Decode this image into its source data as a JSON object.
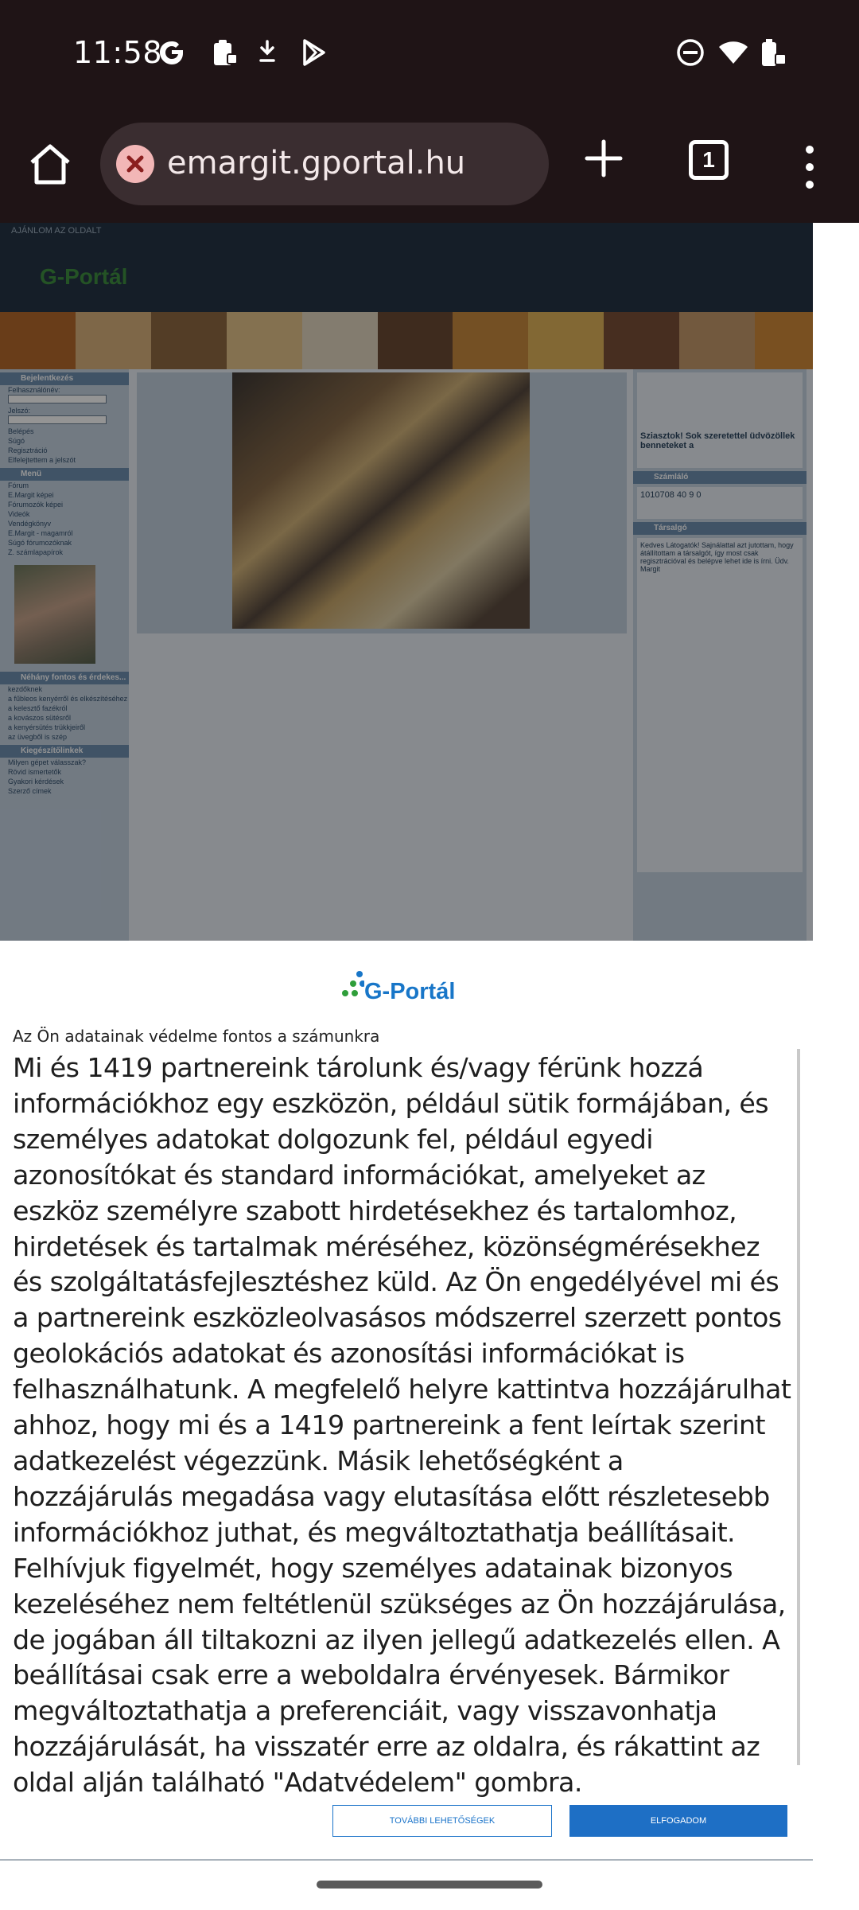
{
  "status_bar": {
    "time": "11:58",
    "left_icons": [
      "google-icon",
      "clipboard-lock-icon",
      "download-icon",
      "play-store-icon"
    ],
    "right_icons": [
      "do-not-disturb-icon",
      "wifi-icon",
      "battery-charging-icon"
    ]
  },
  "browser": {
    "url": "emargit.gportal.hu",
    "tab_count": "1",
    "icons": [
      "home-icon",
      "site-info-warning-icon",
      "new-tab-icon",
      "tabs-icon",
      "more-menu-icon"
    ]
  },
  "website": {
    "recommend_link": "AJÁNLOM AZ OLDALT",
    "logo_text": "G-Portál",
    "login": {
      "heading": "Bejelentkezés",
      "user_label": "Felhasználónév:",
      "password_label": "Jelszó:",
      "login_button": "Belépés",
      "help_link": "Súgó",
      "register_link": "Regisztráció",
      "forgot_link": "Elfelejtettem a jelszót"
    },
    "menu": {
      "heading": "Menü",
      "items": [
        "Fórum",
        "E.Margit képei",
        "Fórumozók képei",
        "Videók",
        "Vendégkönyv",
        "E.Margit - magamról",
        "Súgó fórumozóknak",
        "Z. számlapapírok"
      ]
    },
    "recipes": {
      "heading": "Néhány fontos és érdekes...",
      "items": [
        "kezdőknek",
        "a fűbleos kenyérről és elkészítéséhez",
        "a kelesztő fazékról",
        "a kovászos sütésről",
        "a kenyérsütés trükkjeiről",
        "az üvegből is szép"
      ]
    },
    "extras": {
      "heading": "Kiegészítőlinkek",
      "items": [
        "Milyen gépet válasszak?",
        "Rövid ismertetők",
        "Gyakori kérdések",
        "Szerző címek"
      ]
    },
    "welcome_text": "Sziasztok! Sok szeretettel üdvözöllek benneteket a",
    "counter": {
      "heading": "Számláló",
      "values": [
        "1010708",
        "40",
        "9",
        "0"
      ]
    },
    "chat": {
      "heading": "Társalgó",
      "text": "Kedves Látogatók! Sajnálattal azt jutottam, hogy átállítottam a társalgót, így most csak regisztrációval és belépve lehet ide is írni. Üdv. Margit"
    }
  },
  "consent": {
    "logo_text": "G-Portál",
    "heading": "Az Ön adatainak védelme fontos a számunkra",
    "body_lines": [
      "Mi és 1419 partnereink tárolunk és/vagy férünk hozzá",
      "információkhoz egy eszközön, például sütik formájában, és",
      "személyes adatokat dolgozunk fel, például egyedi",
      "azonosítókat és standard információkat, amelyeket az",
      "eszköz személyre szabott hirdetésekhez és tartalomhoz,",
      "hirdetések és tartalmak méréséhez, közönségmérésekhez",
      "és szolgáltatásfejlesztéshez küld. Az Ön engedélyével mi és",
      "a partnereink eszközleolvasásos módszerrel szerzett pontos",
      "geolokációs adatokat és azonosítási információkat is",
      "felhasználhatunk. A megfelelő helyre kattintva hozzájárulhat",
      "ahhoz, hogy mi és a 1419 partnereink a fent leírtak szerint",
      "adatkezelést végezzünk. Másik lehetőségként a",
      "hozzájárulás megadása vagy elutasítása előtt részletesebb",
      "információkhoz juthat, és megváltoztathatja beállításait.",
      "Felhívjuk figyelmét, hogy személyes adatainak bizonyos",
      "kezeléséhez nem feltétlenül szükséges az Ön hozzájárulása,",
      "de jogában áll tiltakozni az ilyen jellegű adatkezelés ellen. A",
      "beállításai csak erre a weboldalra érvényesek. Bármikor",
      "megváltoztathatja a preferenciáit, vagy visszavonhatja",
      "hozzájárulását, ha visszatér erre az oldalra, és rákattint az",
      "oldal alján található \"Adatvédelem\" gombra."
    ],
    "more_options_button": "TOVÁBBI LEHETŐSÉGEK",
    "accept_button": "ELFOGADOM"
  }
}
